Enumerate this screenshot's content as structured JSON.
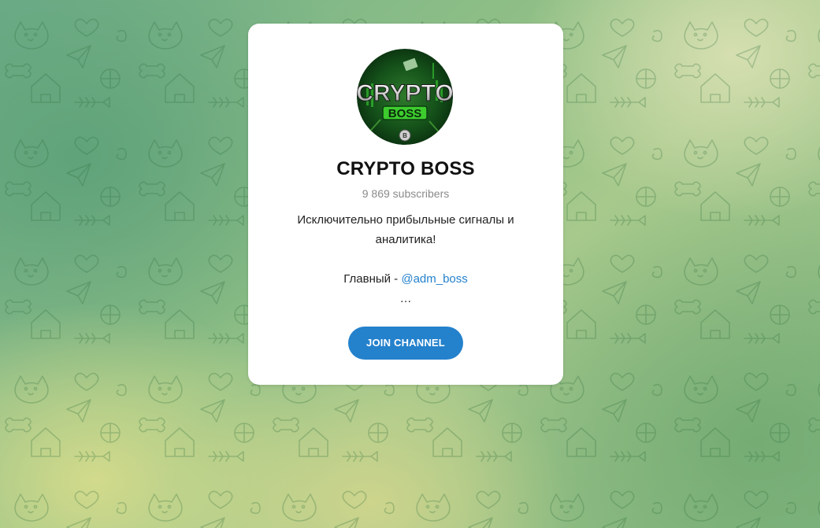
{
  "channel": {
    "name": "CRYPTO BOSS",
    "subscribers": "9 869 subscribers",
    "description_line1": "Исключительно прибыльные сигналы и",
    "description_line2": "аналитика!",
    "main_label": "Главный - ",
    "main_link": "@adm_boss",
    "ellipsis": "…",
    "join_label": "JOIN CHANNEL"
  },
  "avatar": {
    "text_top": "CRYPTO",
    "text_bottom": "BOSS"
  },
  "colors": {
    "accent": "#2481cc",
    "card": "#ffffff",
    "subtitle": "#8a8a8a"
  }
}
